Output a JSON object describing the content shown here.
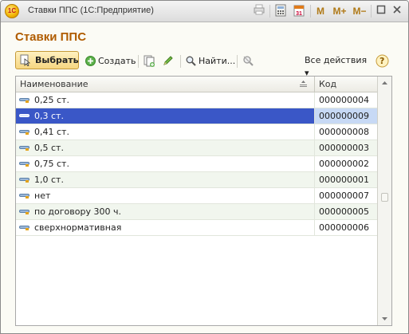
{
  "window": {
    "title": "Ставки ППС  (1С:Предприятие)",
    "app_icon_text": "1С",
    "buttons": {
      "m": "M",
      "m_plus": "M+",
      "m_minus": "M−"
    }
  },
  "form": {
    "title": "Ставки ППС"
  },
  "toolbar": {
    "select_label": "Выбрать",
    "create_label": "Создать",
    "find_label": "Найти...",
    "all_actions_label": "Все действия ▾",
    "help_label": "?"
  },
  "table": {
    "columns": {
      "name": "Наименование",
      "code": "Код"
    },
    "rows": [
      {
        "name": "0,25 ст.",
        "code": "000000004"
      },
      {
        "name": "0,3 ст.",
        "code": "000000009"
      },
      {
        "name": "0,41 ст.",
        "code": "000000008"
      },
      {
        "name": "0,5 ст.",
        "code": "000000003"
      },
      {
        "name": "0,75 ст.",
        "code": "000000002"
      },
      {
        "name": "1,0 ст.",
        "code": "000000001"
      },
      {
        "name": "нет",
        "code": "000000007"
      },
      {
        "name": "по договору 300 ч.",
        "code": "000000005"
      },
      {
        "name": "сверхнормативная",
        "code": "000000006"
      }
    ],
    "selected_index": 1
  },
  "colors": {
    "accent": "#b05c00",
    "selection": "#3a57c7",
    "row_alt": "#f1f6ee"
  }
}
